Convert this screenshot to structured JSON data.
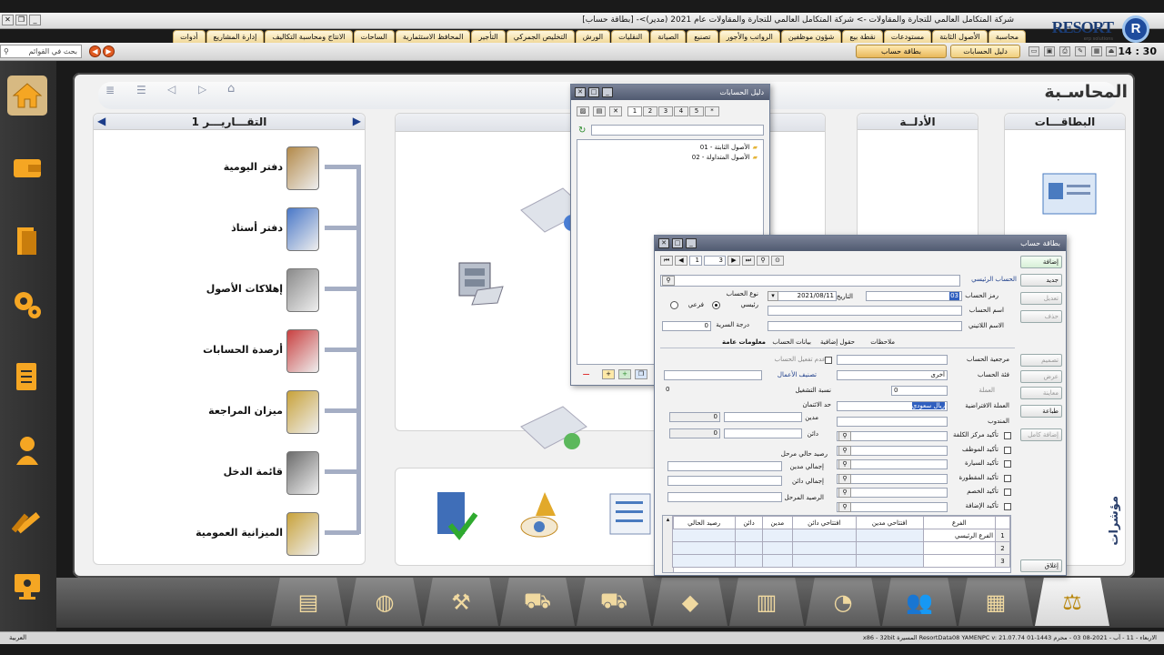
{
  "window": {
    "title": "شركة المتكامل العالمي للتجارة والمقاولات ->  شركة المتكامل العالمي للتجارة والمقاولات عام 2021 (مدير)>- [بطاقة حساب]"
  },
  "logo": {
    "brand": "RESORT",
    "sub": "erp solutions",
    "mark": "R"
  },
  "menu": [
    "محاسبة",
    "الأصول الثابتة",
    "مستودعات",
    "نقطة بيع",
    "شؤون موظفين",
    "الرواتب والأجور",
    "تصنيع",
    "الصيانة",
    "النقليات",
    "الورش",
    "التخليص الجمركي",
    "التأجير",
    "المحافظ الاستثمارية",
    "الساحات",
    "الانتاج ومحاسبة التكاليف",
    "إدارة المشاريع",
    "أدوات"
  ],
  "toolbar": {
    "clock": "14 : 30",
    "open_windows": [
      "دليل الحسابات",
      "بطاقة حساب"
    ],
    "search_placeholder": "بحث في القوائم"
  },
  "main": {
    "page_title": "المحاسـبة",
    "sections": {
      "cards": "البطاقـــات",
      "guides": "الأدلــة",
      "reports_title": "التقـــاريـــر 1"
    },
    "reports": [
      "دفتر اليومية",
      "دفتر أستاذ",
      "إهلاكات الأصول",
      "أرصدة الحسابات",
      "ميزان المراجعة",
      "قائمة الدخل",
      "الميزانية العمومية"
    ],
    "side_text": "مؤشرات"
  },
  "accounts_guide": {
    "title": "دليل الحسابات",
    "tabs": [
      "1",
      "2",
      "3",
      "4",
      "5",
      "*"
    ],
    "tree": [
      "الأصول الثابتة - 01",
      "الأصول المتداولة - 02"
    ]
  },
  "account_card": {
    "title": "بطاقة حساب",
    "nav": {
      "page": "1",
      "total": "3"
    },
    "labels": {
      "main_account": "الحساب الرئيسي",
      "account_code": "رمز الحساب",
      "date": "التاريخ",
      "account_type": "نوع الحساب",
      "type_main": "رئيسي",
      "type_sub": "فرعي",
      "account_name": "اسم الحساب",
      "latin_name": "الاسم اللاتيني",
      "security_level": "درجة السرية",
      "account_ref": "مرجعية الحساب",
      "no_activate": "عدم تفعيل الحساب",
      "account_category": "فئة الحساب",
      "business_class": "تصنيف الأعمال",
      "currency": "العملة",
      "run_ratio": "نسبة التشغيل",
      "default_currency": "العملة الافتراضية",
      "credit_limit": "حد الائتمان",
      "delegate": "المندوب",
      "debit": "مدين",
      "credit": "دائن",
      "current_balance": "رصيد حالي مرحل",
      "total_debit": "إجمالي مدين",
      "total_credit": "إجمالي دائن",
      "carried_balance": "الرصيد المرحل",
      "confirm_cost_center": "تأكيد مركز الكلفة",
      "confirm_employee": "تأكيد الموظف",
      "confirm_vehicle": "تأكيد السيارة",
      "confirm_trailer": "تأكيد المقطورة",
      "confirm_opponent": "تأكيد الخصم",
      "confirm_addition": "تأكيد الإضافة"
    },
    "tabs": [
      "معلومات عامة",
      "بيانات الحساب",
      "حقول إضافية",
      "ملاحظات"
    ],
    "values": {
      "code": "03",
      "date": "2021/08/11",
      "currency": "0",
      "run_ratio": "0",
      "security": "0",
      "category": "أخرى",
      "default_currency": "ريال سعودي",
      "debit": "0",
      "credit": "0"
    },
    "buttons": [
      "إضافة",
      "جديد",
      "تعديل",
      "حذف",
      "تصميم",
      "عرض",
      "معاينة",
      "طباعة",
      "إضافة كامل",
      "إغلاق"
    ],
    "grid": {
      "headers": [
        "الفرع",
        "افتتاحي مدين",
        "افتتاحي دائن",
        "مدين",
        "دائن",
        "رصيد الحالي"
      ],
      "rows": [
        [
          "1",
          "الفرع الرئيسي"
        ],
        [
          "2",
          ""
        ],
        [
          "3",
          ""
        ]
      ]
    }
  },
  "status": {
    "text": "الاربعاء - 11 - آب - 2021-08   03 - محرم 1443-01   ResortData08   YAMENPC   v: 21.07.74   المسيرة   x86 - 32bit",
    "lang": "العربية"
  }
}
